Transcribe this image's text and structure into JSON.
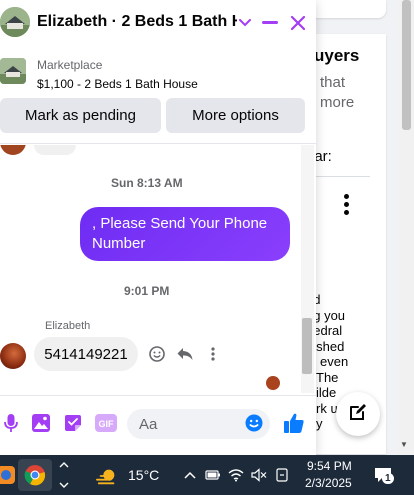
{
  "background": {
    "section_title": "uyers",
    "sub_lines": [
      "that",
      "more"
    ],
    "filter_label": "ear:",
    "paragraph_lines": [
      "od",
      "ng you",
      "hedral",
      "nished",
      "even",
      "The",
      "ilde",
      "rk up",
      "y"
    ]
  },
  "chat": {
    "title": "Elizabeth · 2 Beds 1 Bath H...",
    "listing": {
      "label": "Marketplace",
      "name": "$1,100 - 2 Beds 1 Bath House",
      "mark_pending_label": "Mark as pending",
      "more_options_label": "More options"
    },
    "messages": [
      {
        "timestamp": "Sun 8:13 AM",
        "direction": "out",
        "text": ", Please Send Your Phone Number"
      },
      {
        "timestamp": "9:01 PM",
        "direction": "in",
        "sender": "Elizabeth",
        "text": "5414149221"
      }
    ],
    "composer": {
      "placeholder": "Aa",
      "gif_label": "GIF"
    }
  },
  "taskbar": {
    "weather_temp": "15°C",
    "time": "9:54 PM",
    "date": "2/3/2025",
    "notification_count": "1"
  },
  "colors": {
    "accent": "#a33ef5",
    "bubble_out": "#7431f9",
    "messenger_blue": "#0a7cff",
    "taskbar": "#1c2a3a"
  }
}
